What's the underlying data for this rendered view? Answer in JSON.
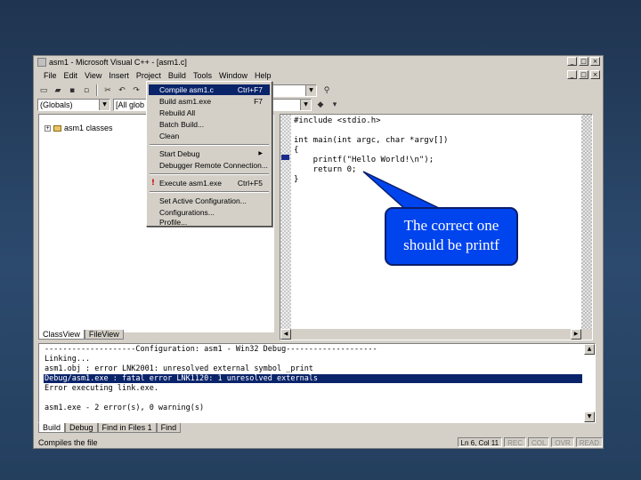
{
  "window": {
    "title": "asm1 - Microsoft Visual C++ - [asm1.c]",
    "controls": [
      "_",
      "□",
      "×"
    ]
  },
  "menubar": {
    "items": [
      "File",
      "Edit",
      "View",
      "Insert",
      "Project",
      "Build",
      "Tools",
      "Window",
      "Help"
    ]
  },
  "toolbar": {
    "scope_combo": "(Globals)",
    "member_combo": "[All glob"
  },
  "build_menu": {
    "items": [
      {
        "label": "Compile asm1.c",
        "shortcut": "Ctrl+F7",
        "highlighted": true
      },
      {
        "label": "Build asm1.exe",
        "shortcut": "F7"
      },
      {
        "label": "Rebuild All",
        "shortcut": ""
      },
      {
        "label": "Batch Build...",
        "shortcut": ""
      },
      {
        "label": "Clean",
        "shortcut": ""
      },
      {
        "label": "Start Debug",
        "shortcut": "▶",
        "separator_before": true
      },
      {
        "label": "Debugger Remote Connection...",
        "shortcut": ""
      },
      {
        "label": "Execute asm1.exe",
        "shortcut": "Ctrl+F5",
        "separator_before": true,
        "icon": "!"
      },
      {
        "label": "Set Active Configuration...",
        "shortcut": "",
        "separator_before": true
      },
      {
        "label": "Configurations...",
        "shortcut": ""
      },
      {
        "label": "Profile...",
        "shortcut": ""
      }
    ]
  },
  "workspace": {
    "tree_root": "asm1 classes",
    "tabs": [
      "ClassView",
      "FileView"
    ]
  },
  "editor": {
    "lines": [
      "#include <stdio.h>",
      "",
      "int main(int argc, char *argv[])",
      "{",
      "    printf(\"Hello World!\\n\");",
      "    return 0;",
      "}"
    ]
  },
  "output": {
    "lines": [
      "--------------------Configuration: asm1 - Win32 Debug--------------------",
      "Linking...",
      "asm1.obj : error LNK2001: unresolved external symbol _print",
      "Debug/asm1.exe : fatal error LNK1120: 1 unresolved externals",
      "Error executing link.exe.",
      "",
      "asm1.exe - 2 error(s), 0 warning(s)"
    ],
    "selected_index": 3,
    "tabs": [
      "Build",
      "Debug",
      "Find in Files 1",
      "Find"
    ]
  },
  "statusbar": {
    "text": "Compiles the file",
    "position": "Ln 6, Col 11",
    "indicators": [
      "REC",
      "COL",
      "OVR",
      "READ"
    ]
  },
  "callout": {
    "line1": "The correct one",
    "line2": "should be printf"
  }
}
